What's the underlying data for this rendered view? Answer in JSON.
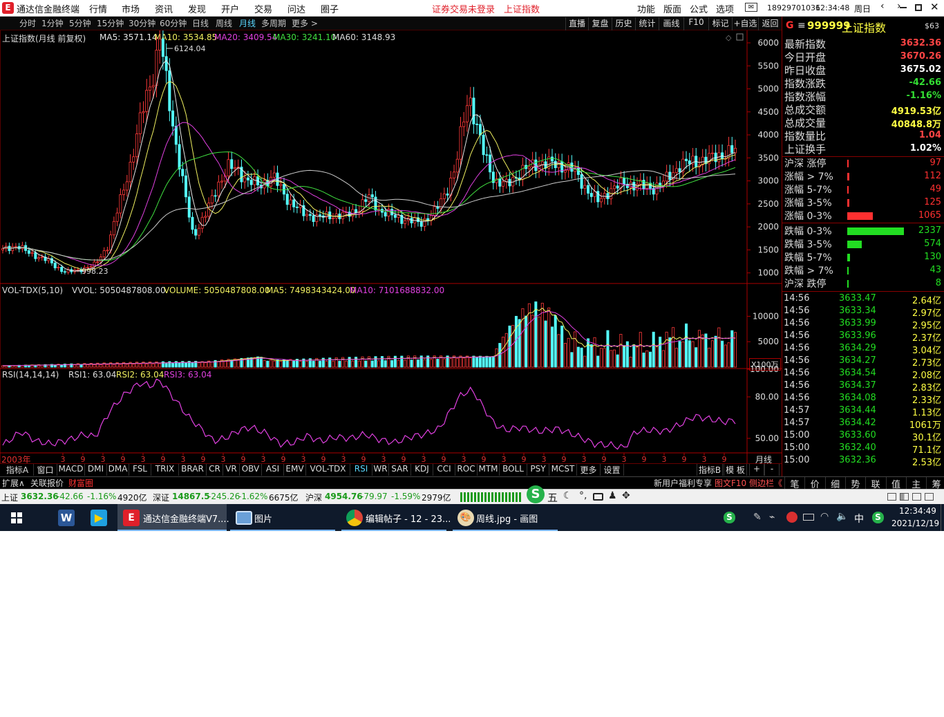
{
  "app": {
    "title": "通达信金融终端"
  },
  "menu": [
    "行情",
    "市场",
    "资讯",
    "发现",
    "开户",
    "交易",
    "问达",
    "圈子"
  ],
  "notice": {
    "login": "证券交易未登录",
    "index": "上证指数"
  },
  "rmenu": [
    "功能",
    "版面",
    "公式",
    "选项"
  ],
  "phone": "18929701036",
  "clock": "12:34:48",
  "weekday": "周日",
  "timeframes": [
    "分时",
    "1分钟",
    "5分钟",
    "15分钟",
    "30分钟",
    "60分钟",
    "日线",
    "周线",
    "月线",
    "多周期",
    "更多 >"
  ],
  "timeframe_active": 8,
  "tools": [
    "直播",
    "复盘",
    "历史",
    "统计",
    "画线",
    "F10",
    "标记",
    "+自选",
    "返回"
  ],
  "main_legend": {
    "title": "上证指数(月线 前复权)",
    "ma5": "MA5: 3571.14",
    "ma10": "MA10: 3534.85",
    "ma20": "MA20: 3409.54",
    "ma30": "MA30: 3241.10",
    "ma60": "MA60: 3148.93"
  },
  "vol_legend": {
    "name": "VOL-TDX(5,10)",
    "vvol": "VVOL: 5050487808.00",
    "volume": "VOLUME: 5050487808.00",
    "ma5": "MA5: 7498343424.00",
    "ma10": "MA10: 7101688832.00"
  },
  "rsi_legend": {
    "name": "RSI(14,14,14)",
    "rsi1": "RSI1: 63.04",
    "rsi2": "RSI2: 63.04",
    "rsi3": "RSI3: 63.04"
  },
  "unit_label": "X100万",
  "x_start": "2003年",
  "x_period": "月线",
  "chart_data": [
    {
      "type": "line",
      "title": "上证指数(月线 前复权)",
      "ylim": [
        800,
        6150
      ],
      "yticks": [
        "6000",
        "5500",
        "5000",
        "4500",
        "4000",
        "3500",
        "3000",
        "2500",
        "2000",
        "1500",
        "1000"
      ],
      "annotations": [
        {
          "x": "2007-10",
          "y": 6124.04,
          "text": "6124.04"
        },
        {
          "x": "2005-06",
          "y": 998.23,
          "text": "998.23"
        }
      ],
      "x": [
        0,
        1,
        2,
        3,
        4,
        5,
        6,
        7,
        8,
        9,
        10,
        11,
        12,
        13,
        14,
        15,
        16,
        17,
        18,
        19,
        20,
        21,
        22,
        23,
        24,
        25
      ],
      "series": [
        {
          "values": [
            1500,
            1600,
            1450,
            1250,
            1060,
            1000,
            1150,
            1400,
            1800,
            2800,
            3800,
            5500,
            6124,
            4800,
            3200,
            1800,
            2300,
            2800,
            3300,
            3100,
            2800,
            2500,
            2300,
            2400,
            2150,
            2200
          ]
        }
      ]
    },
    {
      "type": "bar",
      "title": "VOL-TDX(5,10)",
      "yticks": [
        "10000",
        "5000"
      ]
    },
    {
      "type": "line",
      "title": "RSI(14,14,14)",
      "yticks": [
        "100.00",
        "80.00",
        "50.00"
      ],
      "ylim": [
        40,
        100
      ]
    }
  ],
  "quote": {
    "code": "999999",
    "name": "上证指数",
    "badge": "$63",
    "rows": [
      {
        "label": "最新指数",
        "value": "3632.36",
        "color": "#ff4444"
      },
      {
        "label": "今日开盘",
        "value": "3670.26",
        "color": "#ff4444"
      },
      {
        "label": "昨日收盘",
        "value": "3675.02",
        "color": "#ffffff"
      },
      {
        "label": "指数涨跌",
        "value": "-42.66",
        "color": "#33dd33"
      },
      {
        "label": "指数涨幅",
        "value": "-1.16%",
        "color": "#33dd33"
      },
      {
        "label": "总成交额",
        "value": "4919.53亿",
        "color": "#ffff44"
      },
      {
        "label": "总成交量",
        "value": "40848.8万",
        "color": "#ffff44"
      },
      {
        "label": "指数量比",
        "value": "1.04",
        "color": "#ff4444"
      },
      {
        "label": "上证换手",
        "value": "1.02%",
        "color": "#ffffff"
      }
    ]
  },
  "breadth": {
    "up": [
      {
        "label": "沪深 涨停",
        "value": "97",
        "bar": 0.03
      },
      {
        "label": "涨幅 > 7%",
        "value": "112",
        "bar": 0.04
      },
      {
        "label": "涨幅 5-7%",
        "value": "49",
        "bar": 0.02
      },
      {
        "label": "涨幅 3-5%",
        "value": "125",
        "bar": 0.04
      },
      {
        "label": "涨幅 0-3%",
        "value": "1065",
        "bar": 0.45
      }
    ],
    "down": [
      {
        "label": "跌幅 0-3%",
        "value": "2337",
        "bar": 1.0
      },
      {
        "label": "跌幅 3-5%",
        "value": "574",
        "bar": 0.25
      },
      {
        "label": "跌幅 5-7%",
        "value": "130",
        "bar": 0.05
      },
      {
        "label": "跌幅 > 7%",
        "value": "43",
        "bar": 0.02
      },
      {
        "label": "沪深 跌停",
        "value": "8",
        "bar": 0.01
      }
    ]
  },
  "ticks": [
    {
      "t": "14:56",
      "p": "3633.47",
      "a": "2.64亿"
    },
    {
      "t": "14:56",
      "p": "3633.34",
      "a": "2.97亿"
    },
    {
      "t": "14:56",
      "p": "3633.99",
      "a": "2.95亿"
    },
    {
      "t": "14:56",
      "p": "3633.96",
      "a": "2.37亿"
    },
    {
      "t": "14:56",
      "p": "3634.29",
      "a": "3.04亿"
    },
    {
      "t": "14:56",
      "p": "3634.27",
      "a": "2.73亿"
    },
    {
      "t": "14:56",
      "p": "3634.54",
      "a": "2.08亿"
    },
    {
      "t": "14:56",
      "p": "3634.37",
      "a": "2.83亿"
    },
    {
      "t": "14:56",
      "p": "3634.08",
      "a": "2.33亿"
    },
    {
      "t": "14:57",
      "p": "3634.44",
      "a": "1.13亿"
    },
    {
      "t": "14:57",
      "p": "3634.42",
      "a": "1061万"
    },
    {
      "t": "15:00",
      "p": "3633.60",
      "a": "30.1亿"
    },
    {
      "t": "15:00",
      "p": "3632.40",
      "a": "71.1亿"
    },
    {
      "t": "15:00",
      "p": "3632.36",
      "a": "2.53亿"
    }
  ],
  "indicators": [
    "指标A",
    "窗口",
    "MACD",
    "DMI",
    "DMA",
    "FSL",
    "TRIX",
    "BRAR",
    "CR",
    "VR",
    "OBV",
    "ASI",
    "EMV",
    "VOL-TDX",
    "RSI",
    "WR",
    "SAR",
    "KDJ",
    "CCI",
    "ROC",
    "MTM",
    "BOLL",
    "PSY",
    "MCST",
    "更多",
    "设置"
  ],
  "indicator_active": 14,
  "indicator_right": [
    "指标B",
    "模 板",
    "+",
    "-"
  ],
  "bottom_left": [
    "扩展∧",
    "关联报价",
    "财富圈"
  ],
  "bottom_mid": "新用户福利专享",
  "bottom_right": [
    "图文F10",
    "侧边栏《",
    "笔",
    "价",
    "细",
    "势",
    "联",
    "值",
    "主",
    "筹"
  ],
  "status": {
    "sh": {
      "label": "上证",
      "price": "3632.36",
      "chg": "-42.66",
      "pct": "-1.16%",
      "amt": "4920亿"
    },
    "sz": {
      "label": "深证",
      "price": "14867.5",
      "chg": "-245.26",
      "pct": "-1.62%",
      "amt": "6675亿"
    },
    "hs": {
      "label": "沪深",
      "price": "4954.76",
      "chg": "-79.97",
      "pct": "-1.59%",
      "amt": "2979亿"
    }
  },
  "taskbar": {
    "items": [
      "通达信金融终端V7....",
      "图片",
      "编辑帖子 - 12 - 23...",
      "周线.jpg - 画图"
    ],
    "ime": "中",
    "time": "12:34:49",
    "date": "2021/12/19"
  }
}
